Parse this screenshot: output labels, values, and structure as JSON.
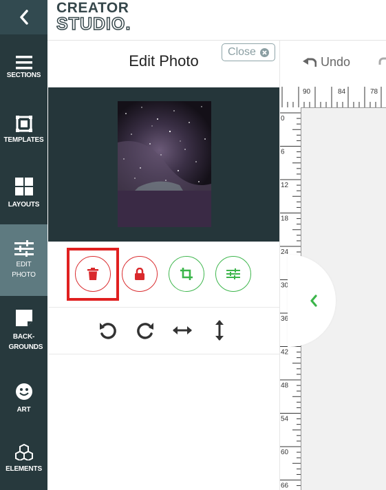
{
  "logo": {
    "line1": "CREATOR",
    "line2": "STUDIO."
  },
  "nav": {
    "items": [
      {
        "label": "SECTIONS",
        "icon": "hamburger-icon"
      },
      {
        "label": "TEMPLATES",
        "icon": "templates-icon"
      },
      {
        "label": "LAYOUTS",
        "icon": "layouts-icon"
      },
      {
        "label": "EDIT PHOTO",
        "icon": "sliders-icon"
      },
      {
        "label": "BACK-GROUNDS",
        "icon": "backgrounds-icon"
      },
      {
        "label": "ART",
        "icon": "smiley-icon"
      },
      {
        "label": "ELEMENTS",
        "icon": "cubes-icon"
      }
    ]
  },
  "panel": {
    "title": "Edit Photo",
    "close_label": "Close",
    "actions": [
      "trash-icon",
      "lock-icon",
      "crop-icon",
      "adjust-icon"
    ],
    "tools": [
      "rotate-left-icon",
      "rotate-right-icon",
      "flip-horizontal-icon",
      "flip-vertical-icon"
    ]
  },
  "toolbar": {
    "undo_label": "Undo"
  },
  "ruler": {
    "h_labels": [
      "90",
      "84",
      "78"
    ],
    "v_labels": [
      "0",
      "6",
      "12",
      "18",
      "24",
      "30",
      "36",
      "42",
      "48",
      "54",
      "60",
      "66"
    ]
  },
  "colors": {
    "nav_bg": "#27393d",
    "nav_active": "#5e7a80",
    "red": "#d9292c",
    "green": "#3bb54a",
    "highlight": "#e02020"
  }
}
